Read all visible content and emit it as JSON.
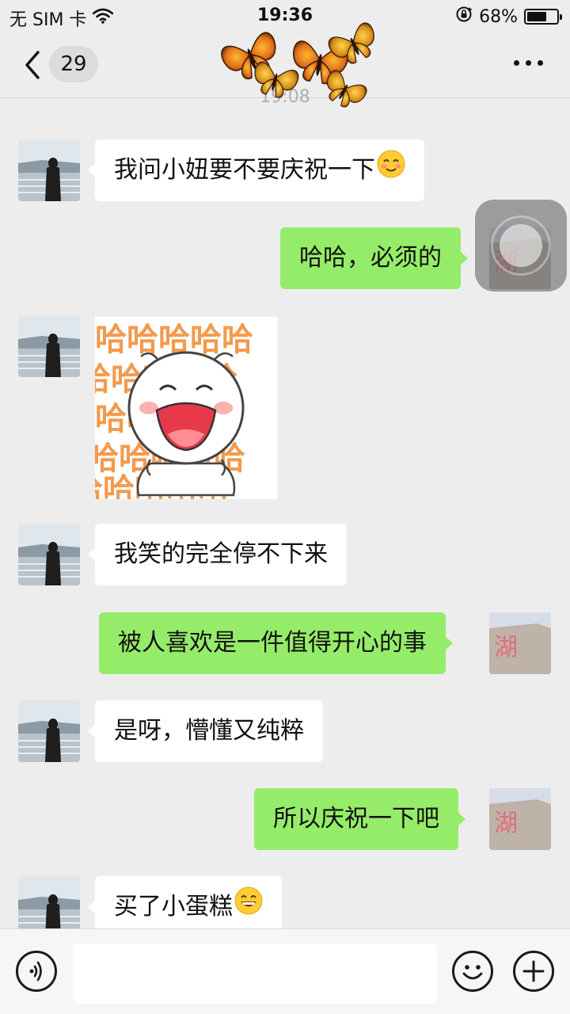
{
  "status_bar": {
    "carrier": "无 SIM 卡",
    "time": "19:36",
    "battery_percent": "68%",
    "battery_level": 0.68,
    "icons": [
      "wifi-icon",
      "rotation-lock-icon",
      "battery-icon"
    ]
  },
  "nav": {
    "unread_count": "29",
    "icons": [
      "back-chevron-icon",
      "more-dots-icon",
      "butterflies-decoration"
    ]
  },
  "peek_timestamp": "19:08",
  "messages": [
    {
      "side": "in",
      "type": "text",
      "text": "我问小妞要不要庆祝一下",
      "emoji": "blushing-smile-emoji"
    },
    {
      "side": "out",
      "type": "text",
      "text": "哈哈，必须的"
    },
    {
      "side": "in",
      "type": "sticker",
      "sticker": "laughing-haha-sticker",
      "sticker_text": "哈哈哈哈哈"
    },
    {
      "side": "in",
      "type": "text",
      "text": "我笑的完全停不下来"
    },
    {
      "side": "out",
      "type": "text",
      "text": "被人喜欢是一件值得开心的事"
    },
    {
      "side": "in",
      "type": "text",
      "text": "是呀，懵懂又纯粹"
    },
    {
      "side": "out",
      "type": "text",
      "text": "所以庆祝一下吧"
    },
    {
      "side": "in",
      "type": "text",
      "text": "买了小蛋糕",
      "emoji": "grinning-emoji"
    }
  ],
  "input": {
    "value": "",
    "icons": [
      "voice-icon",
      "emoji-face-icon",
      "add-plus-icon"
    ]
  },
  "colors": {
    "background": "#ededed",
    "incoming_bubble": "#ffffff",
    "outgoing_bubble": "#95ec69",
    "emoji_yellow": "#ffcc33",
    "sticker_orange": "#f39a4c"
  }
}
